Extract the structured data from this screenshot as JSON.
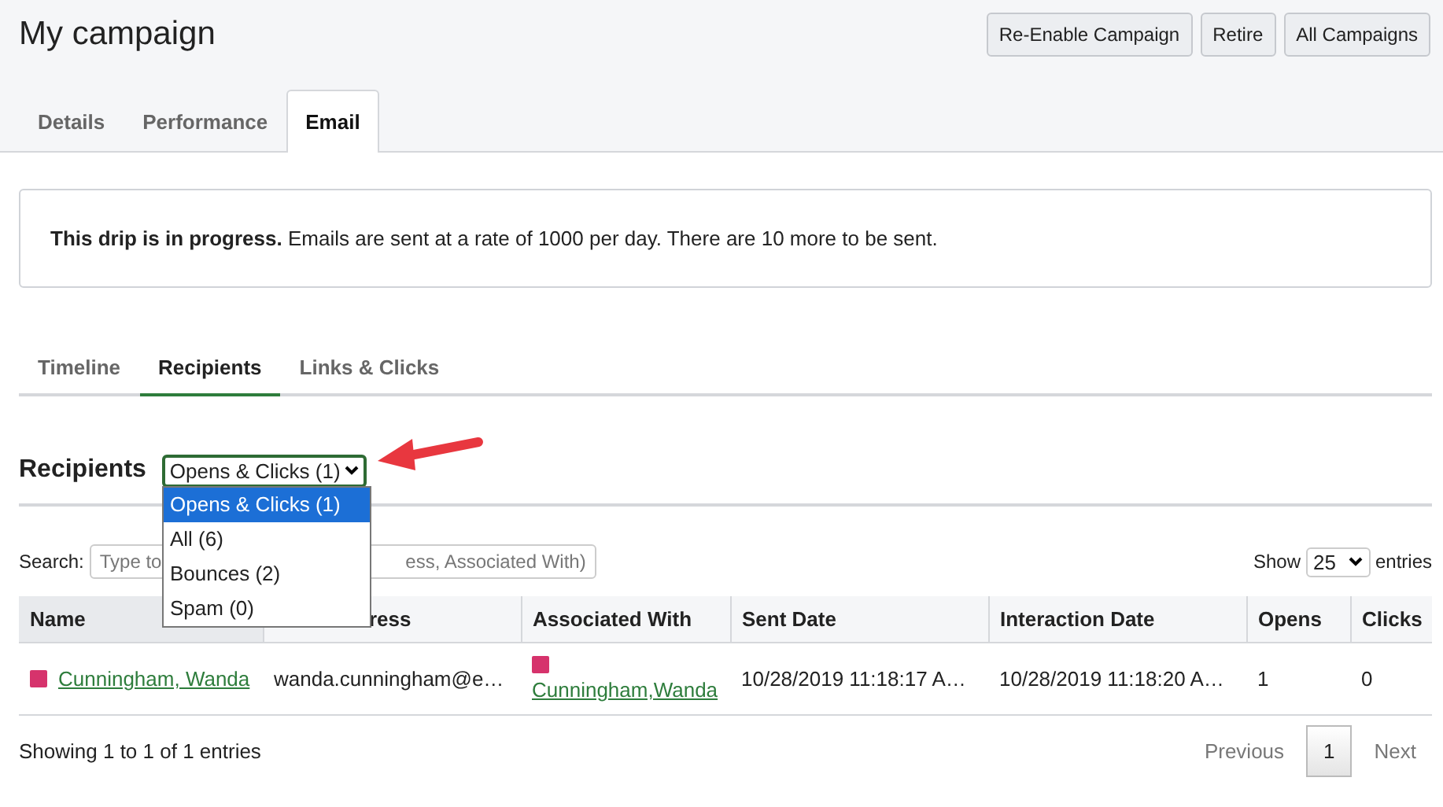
{
  "title": "My campaign",
  "actions": [
    "Re-Enable Campaign",
    "Retire",
    "All Campaigns"
  ],
  "tabs": [
    {
      "label": "Details",
      "selected": false
    },
    {
      "label": "Performance",
      "selected": false
    },
    {
      "label": "Email",
      "selected": true
    }
  ],
  "alert": "**This drip is in progress.** Emails are sent at a rate of 1000 per day. There are 10 more to be sent.",
  "subtabs": [
    {
      "label": "Timeline",
      "selected": false
    },
    {
      "label": "Recipients",
      "selected": true
    },
    {
      "label": "Links & Clicks",
      "selected": false
    }
  ],
  "recipients": {
    "heading": "Recipients",
    "filter": "Opens & Clicks (1)",
    "options": [
      {
        "label": "Opens & Clicks (1)",
        "selected": true
      },
      {
        "label": "All (6)",
        "selected": false
      },
      {
        "label": "Bounces (2)",
        "selected": false
      },
      {
        "label": "Spam (0)",
        "selected": false
      }
    ]
  },
  "search": {
    "label": "Search:",
    "placeholder": "Type to",
    "placeholder_tail": "ess, Associated With)"
  },
  "page_size": {
    "label_before": "Show",
    "value": "25",
    "label_after": "entries"
  },
  "table": {
    "columns": [
      "Name",
      "ress",
      "Associated With",
      "Sent Date",
      "Interaction Date",
      "Opens",
      "Clicks"
    ],
    "rows": [
      {
        "name": "Cunningham, Wanda",
        "email": "wanda.cunningham@e…",
        "associated": "Cunningham,Wanda",
        "sent": "10/28/2019 11:18:17 A…",
        "interaction": "10/28/2019 11:18:20 A…",
        "opens": "1",
        "clicks": "0"
      }
    ]
  },
  "info": "Showing 1 to 1 of 1 entries",
  "pagination": {
    "previous": "Previous",
    "pages": [
      {
        "label": "1",
        "selected": true
      }
    ],
    "next": "Next"
  }
}
